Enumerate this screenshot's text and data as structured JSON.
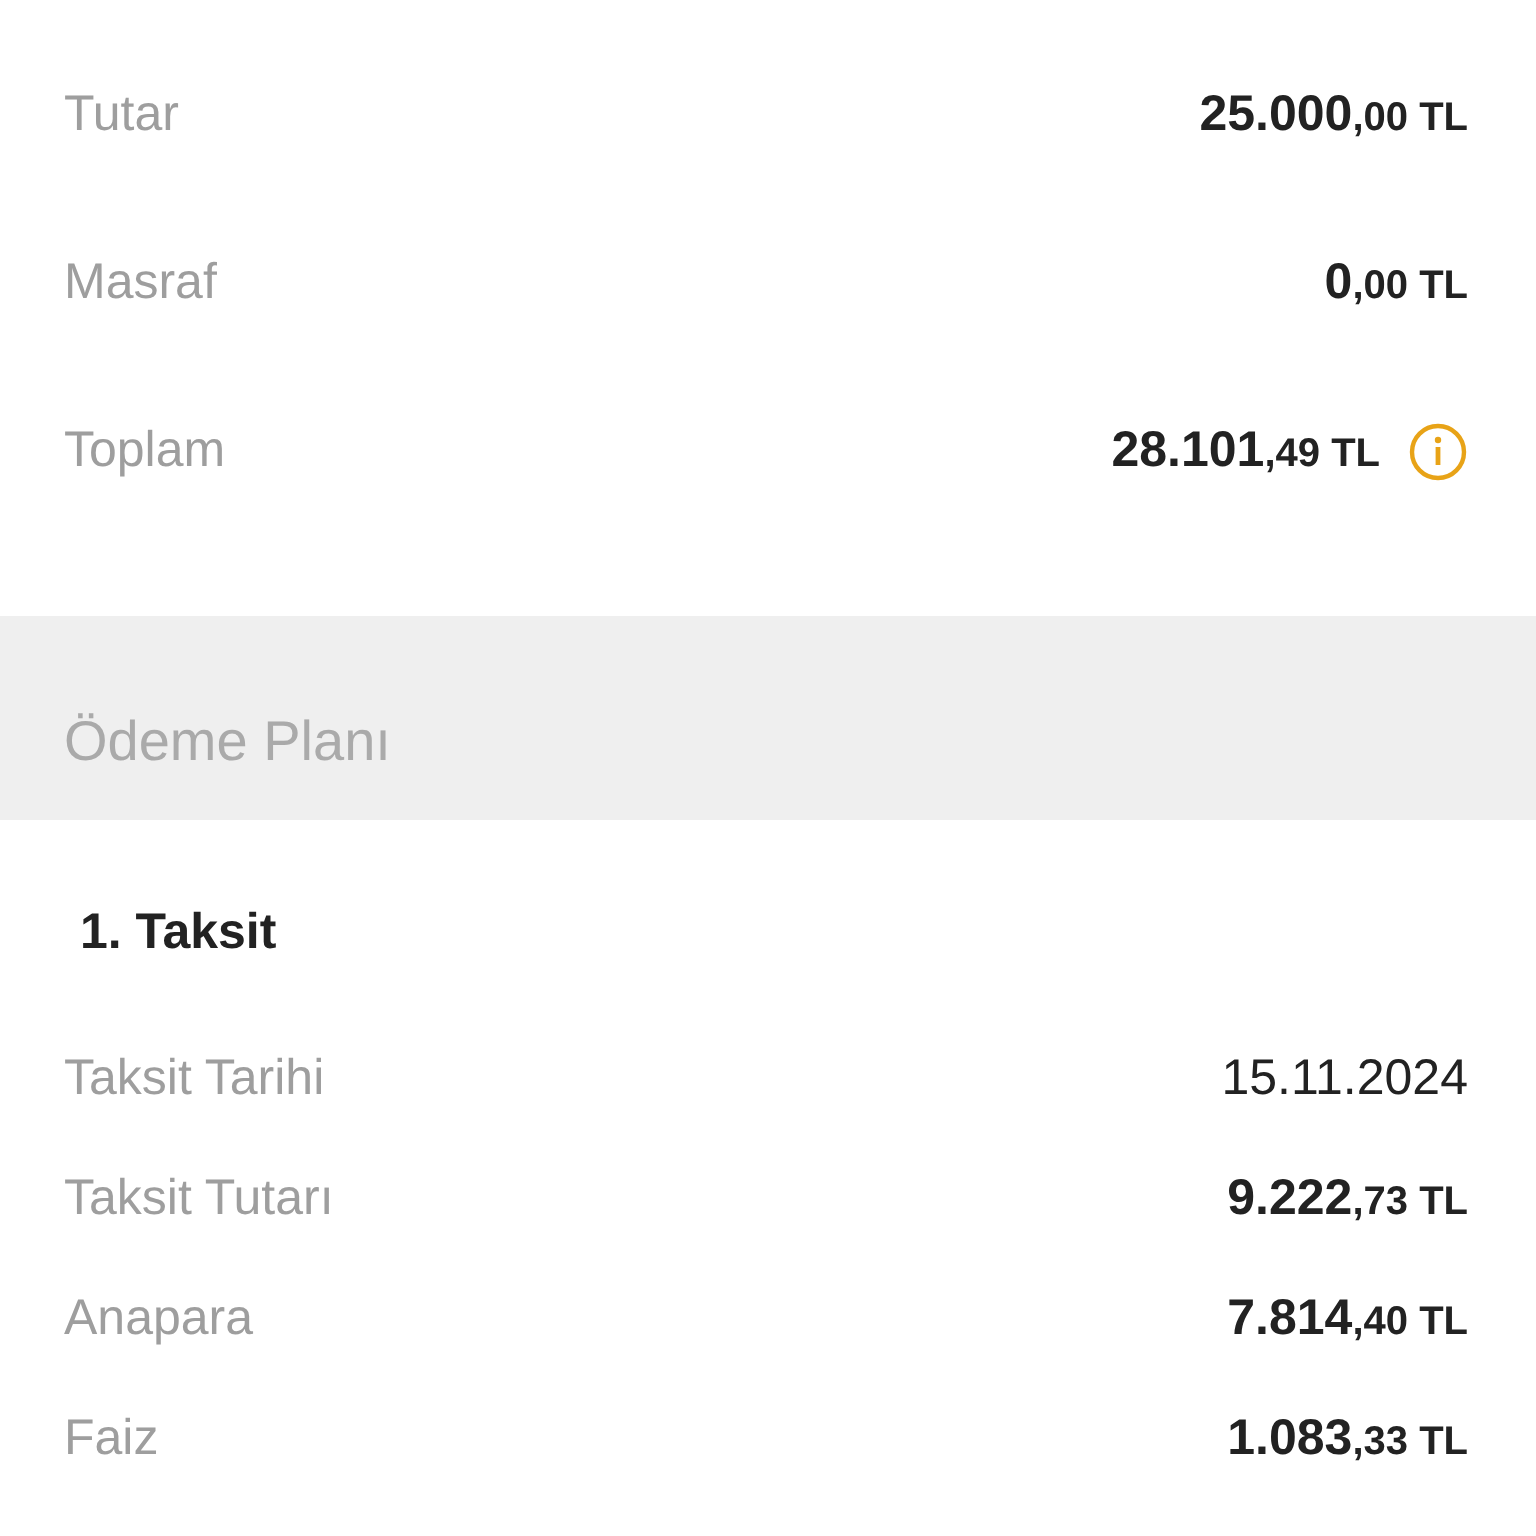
{
  "summary": [
    {
      "label": "Tutar",
      "whole": "25.000",
      "fraction": ",00 TL",
      "info": false
    },
    {
      "label": "Masraf",
      "whole": "0",
      "fraction": ",00 TL",
      "info": false
    },
    {
      "label": "Toplam",
      "whole": "28.101",
      "fraction": ",49 TL",
      "info": true
    }
  ],
  "section_title": "Ödeme Planı",
  "installment": {
    "title": "1. Taksit",
    "rows": [
      {
        "kind": "text",
        "label": "Taksit Tarihi",
        "value": "15.11.2024"
      },
      {
        "kind": "amount",
        "label": "Taksit Tutarı",
        "whole": "9.222",
        "fraction": ",73 TL"
      },
      {
        "kind": "amount",
        "label": "Anapara",
        "whole": "7.814",
        "fraction": ",40 TL"
      },
      {
        "kind": "amount",
        "label": "Faiz",
        "whole": "1.083",
        "fraction": ",33 TL"
      }
    ]
  }
}
